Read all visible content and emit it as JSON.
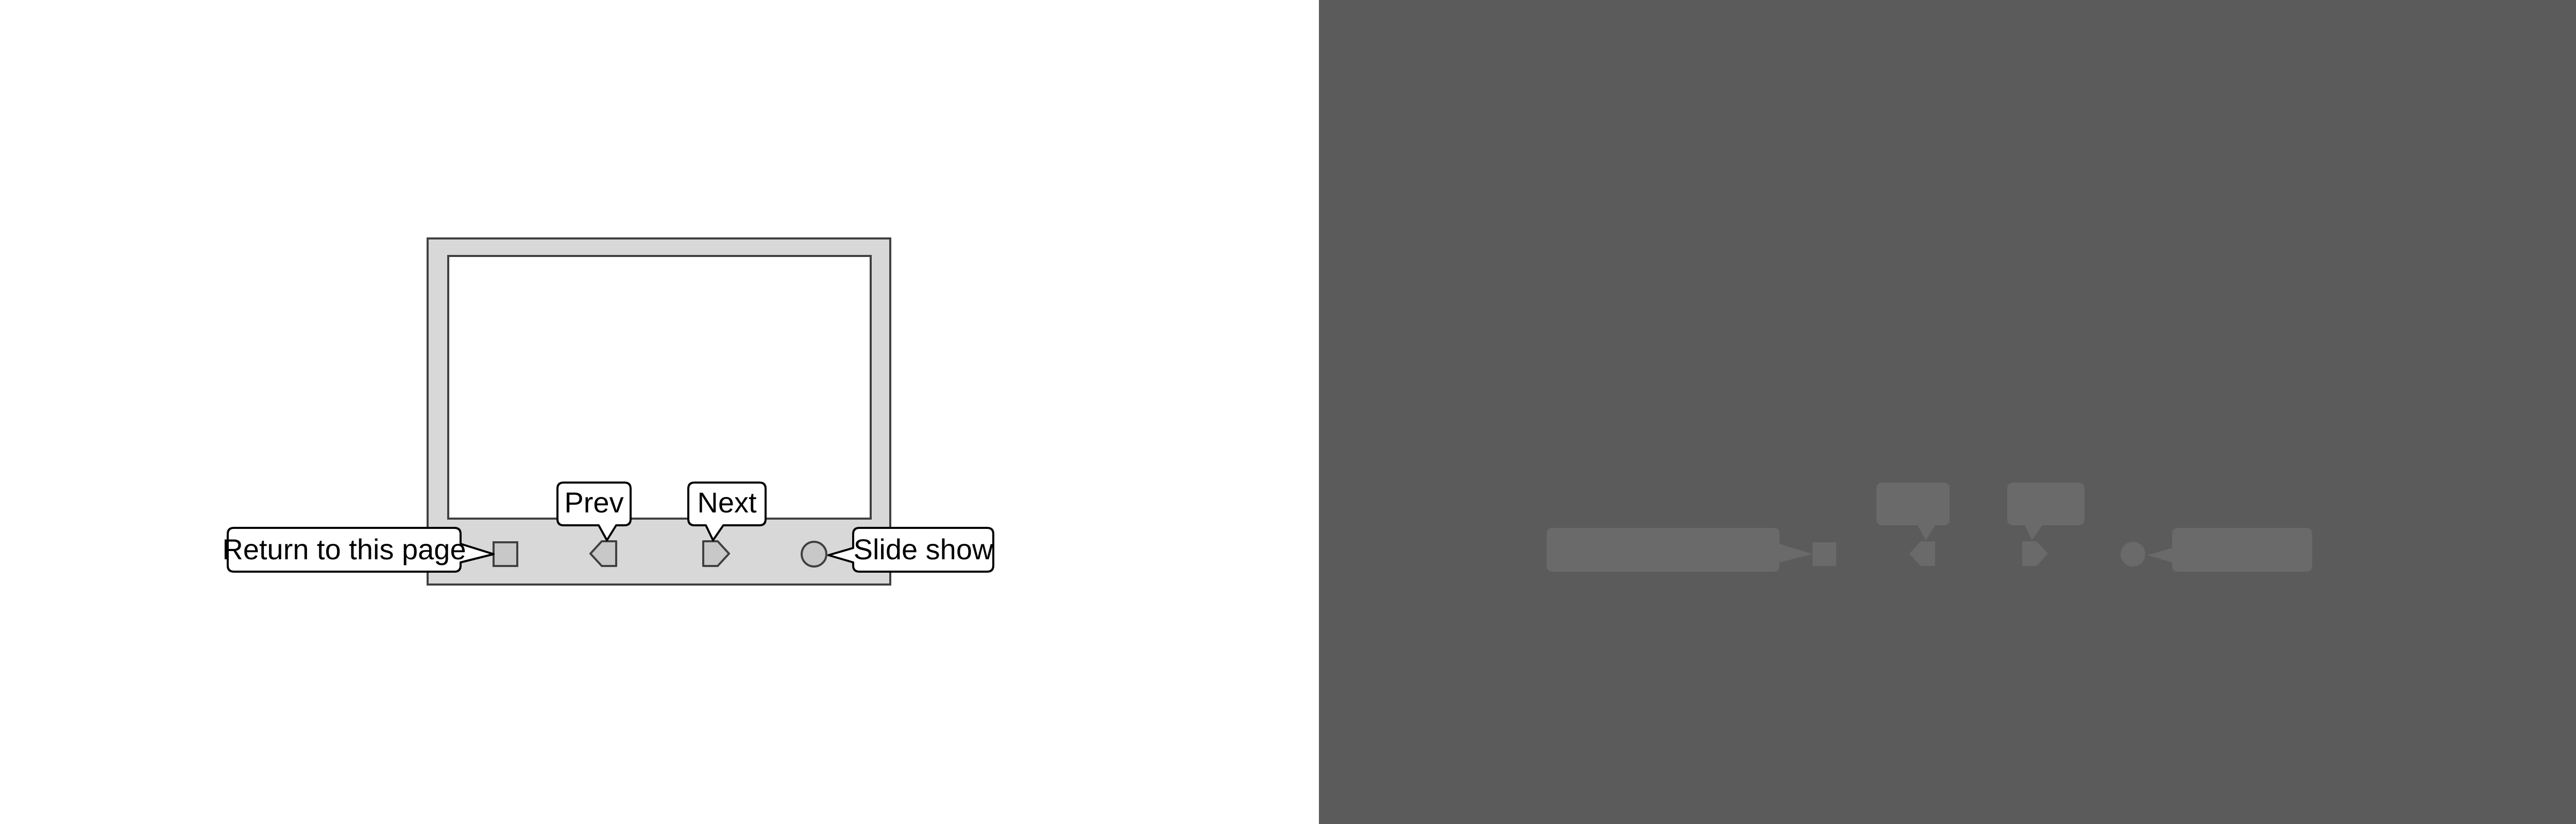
{
  "colors": {
    "left_background": "#ffffff",
    "right_background": "#5b5b5b",
    "frame_fill": "#d8d8d8",
    "frame_stroke": "#404040",
    "screen_fill": "#ffffff",
    "button_fill": "#c8c8c8",
    "callout_fill": "#ffffff",
    "callout_stroke": "#000000",
    "text": "#000000",
    "ghost_fill": "#6a6a6a"
  },
  "buttons": [
    {
      "id": "return",
      "icon": "square-icon",
      "label": "Return to this page"
    },
    {
      "id": "prev",
      "icon": "left-arrow-icon",
      "label": "Prev"
    },
    {
      "id": "next",
      "icon": "right-arrow-icon",
      "label": "Next"
    },
    {
      "id": "slideshow",
      "icon": "circle-icon",
      "label": "Slide show"
    }
  ]
}
